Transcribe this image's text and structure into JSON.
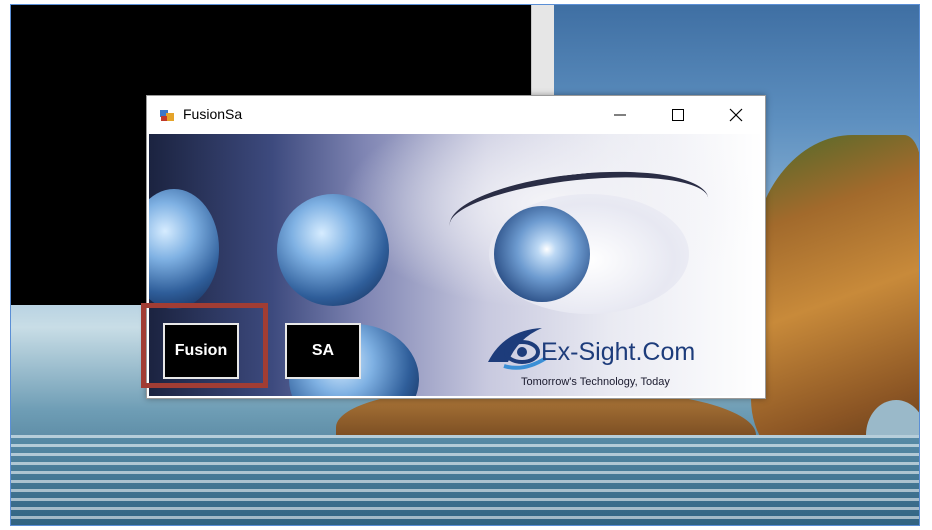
{
  "window": {
    "title": "FusionSa",
    "controls": {
      "minimize": "—",
      "maximize": "☐",
      "close": "✕"
    }
  },
  "buttons": {
    "fusion_label": "Fusion",
    "sa_label": "SA"
  },
  "branding": {
    "name": "Ex-Sight.Com",
    "tagline": "Tomorrow's Technology, Today"
  },
  "colors": {
    "highlight_box": "#a13d34",
    "button_bg": "#000000",
    "brand_text": "#1d3c7b"
  }
}
